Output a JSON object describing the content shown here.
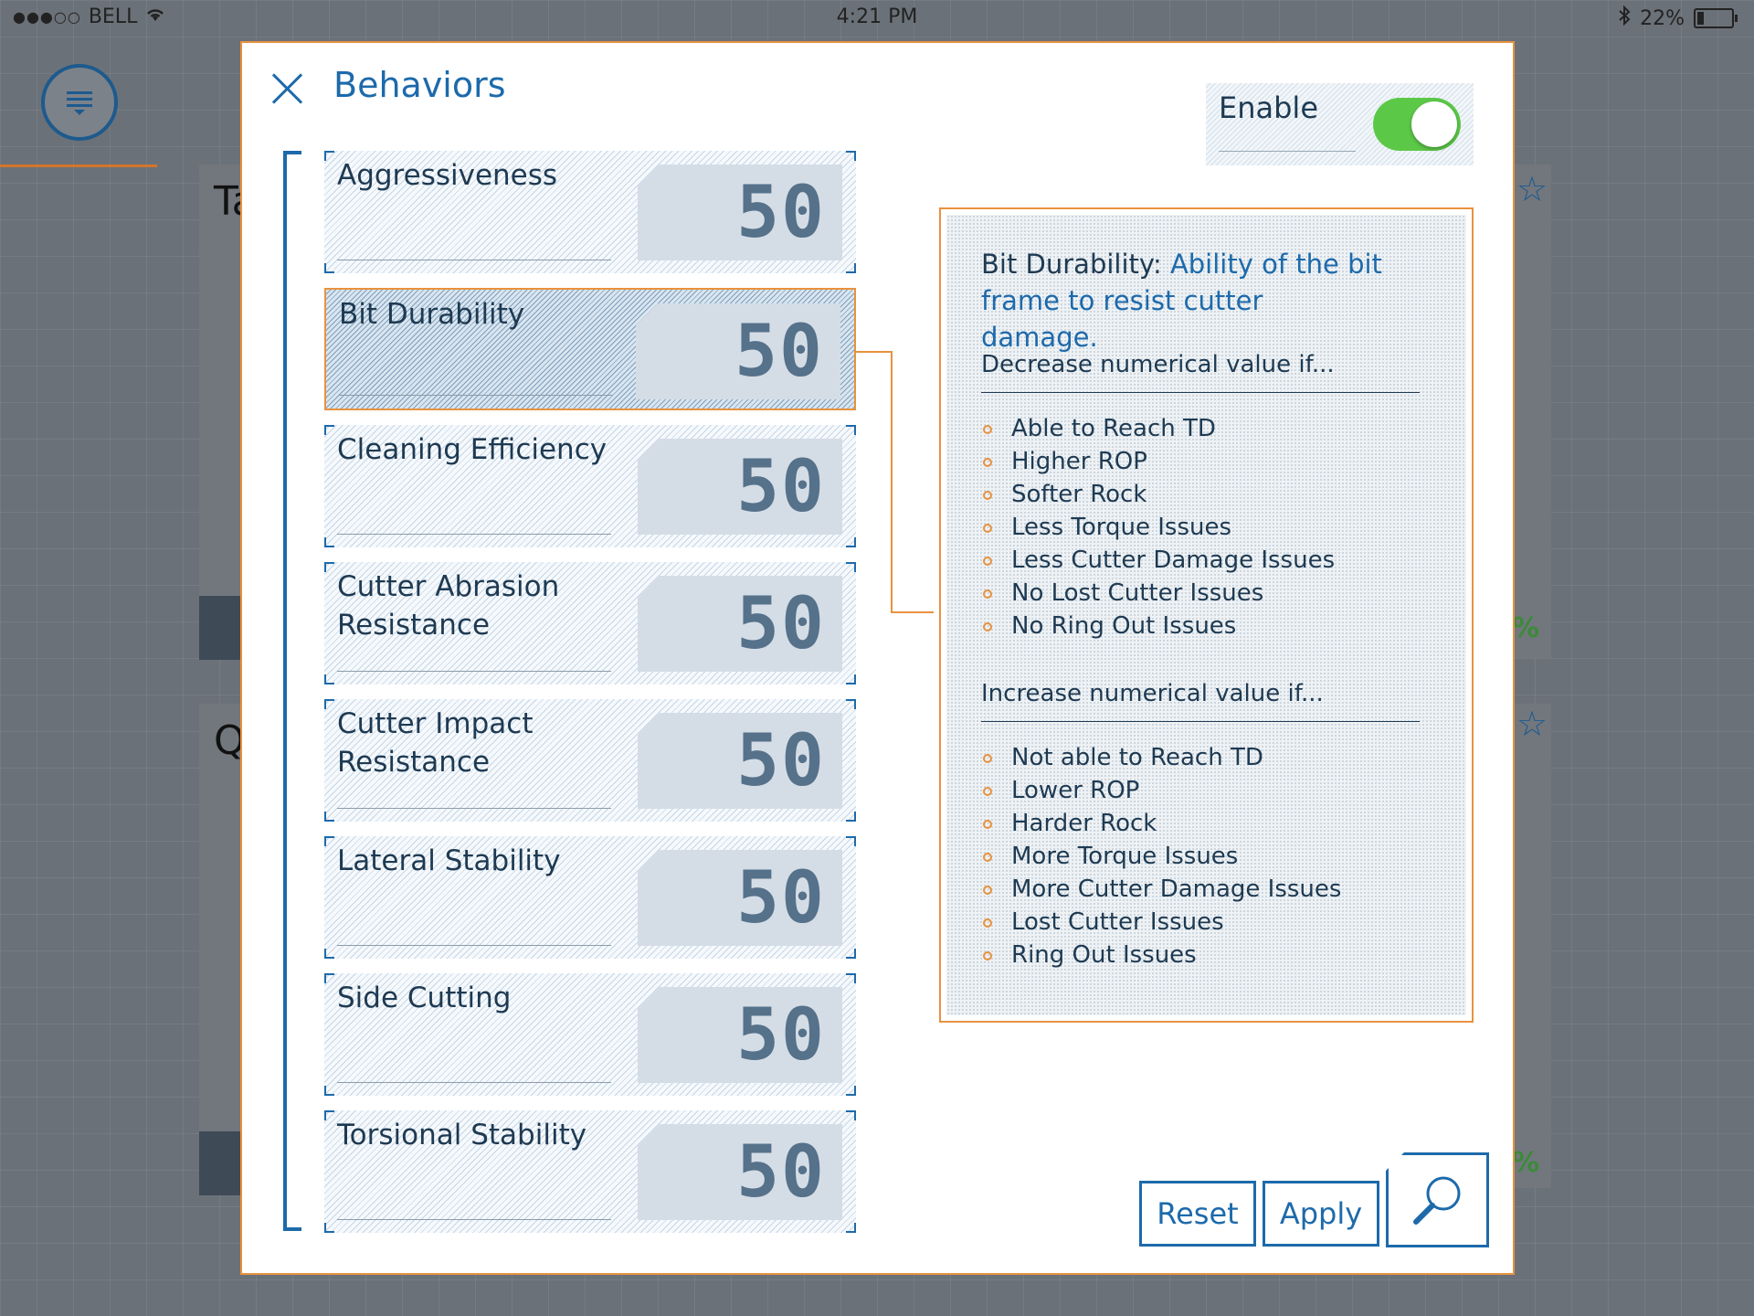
{
  "status_bar": {
    "signal": "●●●○○",
    "carrier": "BELL",
    "time": "4:21 PM",
    "battery": "22%",
    "battery_level": 0.22
  },
  "background": {
    "card1_letter": "Ta",
    "card2_letter": "Q",
    "card1_pct": "%",
    "card2_pct": "%"
  },
  "modal": {
    "title": "Behaviors",
    "enable_label": "Enable",
    "enable_on": true
  },
  "behaviors": [
    {
      "label": "Aggressiveness",
      "value": "50",
      "selected": false
    },
    {
      "label": "Bit Durability",
      "value": "50",
      "selected": true
    },
    {
      "label": "Cleaning Efficiency",
      "value": "50",
      "selected": false
    },
    {
      "label": "Cutter Abrasion Resistance",
      "value": "50",
      "selected": false
    },
    {
      "label": "Cutter Impact Resistance",
      "value": "50",
      "selected": false
    },
    {
      "label": "Lateral Stability",
      "value": "50",
      "selected": false
    },
    {
      "label": "Side Cutting",
      "value": "50",
      "selected": false
    },
    {
      "label": "Torsional Stability",
      "value": "50",
      "selected": false
    }
  ],
  "detail": {
    "name": "Bit Durability:",
    "description": "Ability of the bit frame to resist cutter damage.",
    "decrease_title": "Decrease numerical value if...",
    "decrease_items": [
      "Able to Reach TD",
      "Higher ROP",
      "Softer Rock",
      "Less Torque Issues",
      "Less Cutter Damage Issues",
      "No Lost Cutter Issues",
      "No Ring Out Issues"
    ],
    "increase_title": "Increase numerical value if...",
    "increase_items": [
      "Not able to Reach TD",
      "Lower ROP",
      "Harder Rock",
      "More Torque Issues",
      "More Cutter Damage Issues",
      "Lost Cutter Issues",
      "Ring Out Issues"
    ]
  },
  "buttons": {
    "reset": "Reset",
    "apply": "Apply"
  },
  "colors": {
    "accent_blue": "#1d6aab",
    "accent_orange": "#e8923f",
    "toggle_green": "#5cc848"
  }
}
